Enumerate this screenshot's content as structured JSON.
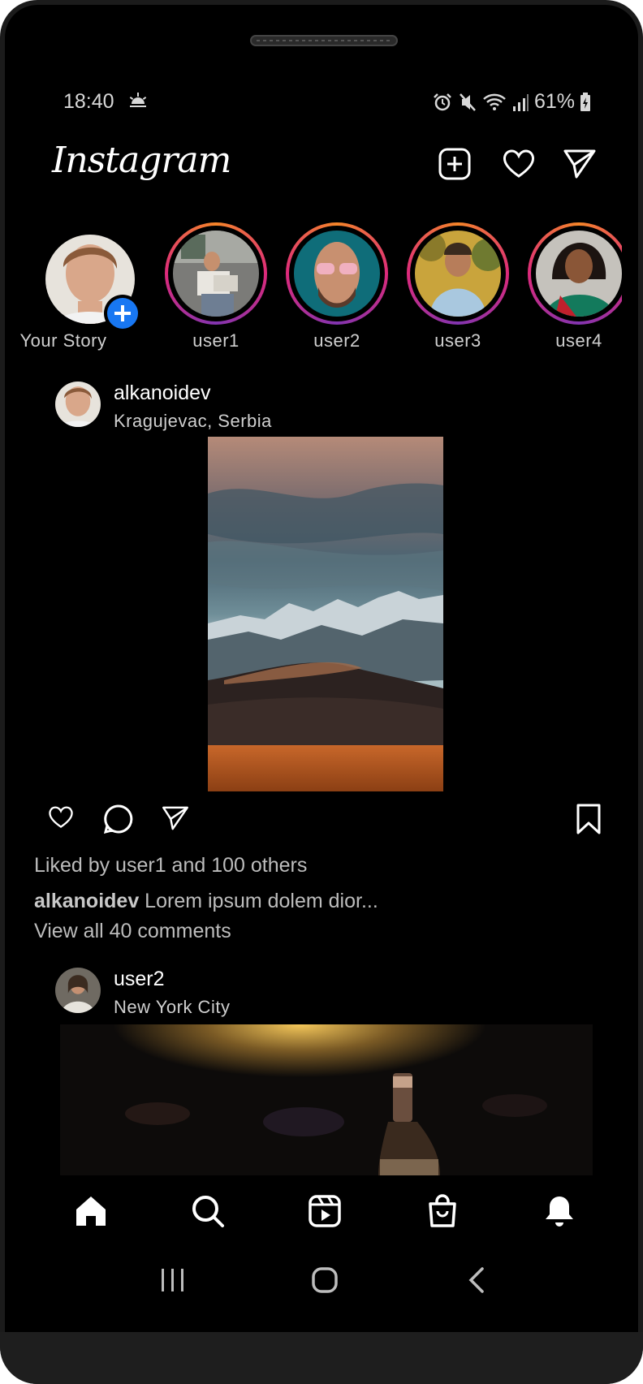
{
  "status_bar": {
    "time": "18:40",
    "battery": "61%",
    "icons": [
      "sunrise-icon",
      "alarm-icon",
      "mute-icon",
      "wifi-icon",
      "signal-icon",
      "battery-charging-icon"
    ]
  },
  "app": {
    "title": "Instagram",
    "header_icons": [
      "new-post-icon",
      "heart-icon",
      "direct-message-icon"
    ]
  },
  "stories": [
    {
      "label": "Your Story"
    },
    {
      "label": "user1"
    },
    {
      "label": "user2"
    },
    {
      "label": "user3"
    },
    {
      "label": "user4"
    }
  ],
  "posts": [
    {
      "username": "alkanoidev",
      "location": "Kragujevac, Serbia",
      "liked_by": "Liked by user1 and 100 others",
      "caption_user": "alkanoidev",
      "caption_text": " Lorem ipsum dolem dior...",
      "comments": "View all 40 comments"
    },
    {
      "username": "user2",
      "location": "New York City"
    }
  ],
  "bottom_nav": [
    "home-icon",
    "search-icon",
    "reels-icon",
    "shop-icon",
    "notifications-icon"
  ],
  "system_nav": [
    "recents-icon",
    "home-circle-icon",
    "back-icon"
  ],
  "colors": {
    "background": "#000000",
    "text": "#ffffff",
    "muted_text": "#bcbcbc",
    "accent_blue": "#1877f2",
    "story_ring": [
      "#f58529",
      "#dd2a7b",
      "#8134af"
    ]
  }
}
